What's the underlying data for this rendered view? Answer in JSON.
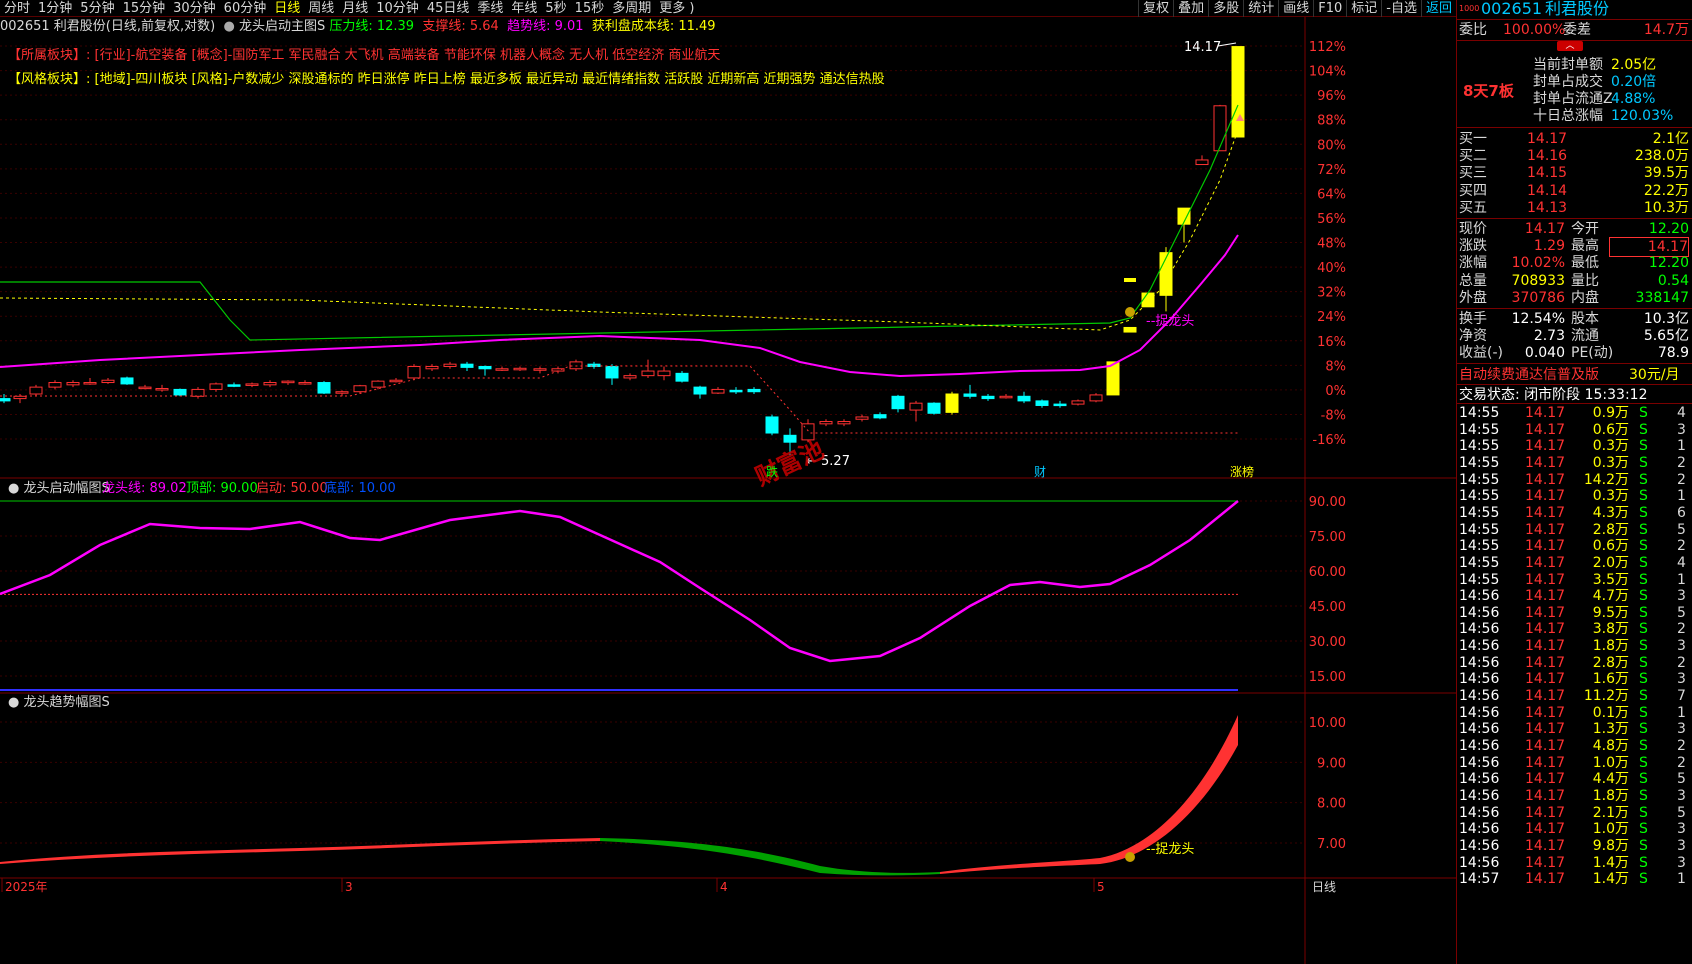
{
  "toolbar": {
    "periods": [
      "分时",
      "1分钟",
      "5分钟",
      "15分钟",
      "30分钟",
      "60分钟",
      "日线",
      "周线",
      "月线",
      "10分钟",
      "45日线",
      "季线",
      "年线",
      "5秒",
      "15秒",
      "多周期",
      "更多 )"
    ],
    "active_period": "日线",
    "right_buttons": [
      "复权",
      "叠加",
      "多股",
      "统计",
      "画线",
      "F10",
      "标记",
      "-自选"
    ],
    "return_label": "返回"
  },
  "titlebar": {
    "stock_desc": "002651 利君股份(日线,前复权,对数)",
    "indicator_name": "龙头启动主图S",
    "pressure": "压力线: 12.39",
    "support": "支撑线: 5.64",
    "trend": "趋势线: 9.01",
    "profit_cost": "获利盘成本线: 11.49"
  },
  "tags": {
    "sector_label": "【所属板块】:",
    "sector_text": "[行业]-航空装备 [概念]-国防军工 军民融合 大飞机 高端装备 节能环保 机器人概念 无人机 低空经济 商业航天",
    "style_label": "【风格板块】:",
    "style_text": "[地域]-四川板块 [风格]-户数减少 深股通标的 昨日涨停 昨日上榜 最近多板 最近异动 最近情绪指数 活跃股 近期新高 近期强势 通达信热股"
  },
  "main_chart": {
    "pct_labels": [
      "112%",
      "104%",
      "96%",
      "88%",
      "80%",
      "72%",
      "64%",
      "56%",
      "48%",
      "40%",
      "32%",
      "24%",
      "16%",
      "8%",
      "0%",
      "-8%",
      "-16%"
    ],
    "pct_values": [
      112,
      104,
      96,
      88,
      80,
      72,
      64,
      56,
      48,
      40,
      32,
      24,
      16,
      8,
      0,
      -8,
      -16
    ],
    "high_label": "14.17",
    "low_label": "5.27",
    "watermark": "财富池",
    "catch_label": "捉龙头",
    "markers": [
      "跌",
      "财",
      "涨榜"
    ]
  },
  "sub1": {
    "name": "龙头启动幅图S",
    "line": "龙头线: 89.02",
    "top": "顶部: 90.00",
    "start": "启动: 50.00",
    "bottom": "底部: 10.00",
    "y_labels": [
      "90.00",
      "75.00",
      "60.00",
      "45.00",
      "30.00",
      "15.00"
    ],
    "y_values": [
      90,
      75,
      60,
      45,
      30,
      15
    ]
  },
  "sub2": {
    "name": "龙头趋势幅图S",
    "y_labels": [
      "10.00",
      "9.00",
      "8.00",
      "7.00"
    ],
    "y_values": [
      10,
      9,
      8,
      7
    ],
    "catch_label": "捉龙头"
  },
  "x_axis": {
    "labels": [
      "2025年",
      "3",
      "4",
      "5"
    ],
    "period_label": "日线"
  },
  "colors": {
    "up": "#ff3232",
    "down": "#00ffff",
    "limit": "#ffff00",
    "magenta": "#ff00ff",
    "green": "#00c800"
  },
  "panel": {
    "code": "002651",
    "name": "利君股份",
    "weibi_label": "委比",
    "weibi": "100.00%",
    "weicha_label": "委差",
    "weicha": "14.7万",
    "board_label": "8天7板",
    "seal": [
      {
        "label": "当前封单额",
        "value": "2.05亿"
      },
      {
        "label": "封单占成交",
        "value": "0.20倍"
      },
      {
        "label": "封单占流通Z",
        "value": "4.88%"
      },
      {
        "label": "十日总涨幅",
        "value": "120.03%"
      }
    ],
    "bids": [
      {
        "label": "买一",
        "price": "14.17",
        "vol": "2.1亿"
      },
      {
        "label": "买二",
        "price": "14.16",
        "vol": "238.0万"
      },
      {
        "label": "买三",
        "price": "14.15",
        "vol": "39.5万"
      },
      {
        "label": "买四",
        "price": "14.14",
        "vol": "22.2万"
      },
      {
        "label": "买五",
        "price": "14.13",
        "vol": "10.3万"
      }
    ],
    "quote": [
      {
        "l1": "现价",
        "v1": "14.17",
        "l2": "今开",
        "v2": "12.20"
      },
      {
        "l1": "涨跌",
        "v1": "1.29",
        "l2": "最高",
        "v2": "14.17"
      },
      {
        "l1": "涨幅",
        "v1": "10.02%",
        "l2": "最低",
        "v2": "12.20"
      },
      {
        "l1": "总量",
        "v1": "708933",
        "l2": "量比",
        "v2": "0.54"
      },
      {
        "l1": "外盘",
        "v1": "370786",
        "l2": "内盘",
        "v2": "338147"
      }
    ],
    "fin": [
      {
        "l1": "换手",
        "v1": "12.54%",
        "l2": "股本",
        "v2": "10.3亿"
      },
      {
        "l1": "净资",
        "v1": "2.73",
        "l2": "流通",
        "v2": "5.65亿"
      },
      {
        "l1": "收益(-)",
        "v1": "0.040",
        "l2": "PE(动)",
        "v2": "78.9"
      }
    ],
    "ad_text": "自动续费通达信普及版",
    "ad_price": "30元/月",
    "status": "交易状态: 闭市阶段 15:33:12",
    "ticks": [
      [
        "14:55",
        "14.17",
        "0.9万",
        "S",
        "4"
      ],
      [
        "14:55",
        "14.17",
        "0.6万",
        "S",
        "3"
      ],
      [
        "14:55",
        "14.17",
        "0.3万",
        "S",
        "1"
      ],
      [
        "14:55",
        "14.17",
        "0.3万",
        "S",
        "2"
      ],
      [
        "14:55",
        "14.17",
        "14.2万",
        "S",
        "2"
      ],
      [
        "14:55",
        "14.17",
        "0.3万",
        "S",
        "1"
      ],
      [
        "14:55",
        "14.17",
        "4.3万",
        "S",
        "6"
      ],
      [
        "14:55",
        "14.17",
        "2.8万",
        "S",
        "5"
      ],
      [
        "14:55",
        "14.17",
        "0.6万",
        "S",
        "2"
      ],
      [
        "14:55",
        "14.17",
        "2.0万",
        "S",
        "4"
      ],
      [
        "14:55",
        "14.17",
        "3.5万",
        "S",
        "1"
      ],
      [
        "14:56",
        "14.17",
        "4.7万",
        "S",
        "3"
      ],
      [
        "14:56",
        "14.17",
        "9.5万",
        "S",
        "5"
      ],
      [
        "14:56",
        "14.17",
        "3.8万",
        "S",
        "2"
      ],
      [
        "14:56",
        "14.17",
        "1.8万",
        "S",
        "3"
      ],
      [
        "14:56",
        "14.17",
        "2.8万",
        "S",
        "2"
      ],
      [
        "14:56",
        "14.17",
        "1.6万",
        "S",
        "3"
      ],
      [
        "14:56",
        "14.17",
        "11.2万",
        "S",
        "7"
      ],
      [
        "14:56",
        "14.17",
        "0.1万",
        "S",
        "1"
      ],
      [
        "14:56",
        "14.17",
        "1.3万",
        "S",
        "3"
      ],
      [
        "14:56",
        "14.17",
        "4.8万",
        "S",
        "2"
      ],
      [
        "14:56",
        "14.17",
        "1.0万",
        "S",
        "2"
      ],
      [
        "14:56",
        "14.17",
        "4.4万",
        "S",
        "5"
      ],
      [
        "14:56",
        "14.17",
        "1.8万",
        "S",
        "3"
      ],
      [
        "14:56",
        "14.17",
        "2.1万",
        "S",
        "5"
      ],
      [
        "14:56",
        "14.17",
        "1.0万",
        "S",
        "3"
      ],
      [
        "14:56",
        "14.17",
        "9.8万",
        "S",
        "3"
      ],
      [
        "14:56",
        "14.17",
        "1.4万",
        "S",
        "3"
      ],
      [
        "14:57",
        "14.17",
        "1.4万",
        "S",
        "1"
      ]
    ]
  }
}
